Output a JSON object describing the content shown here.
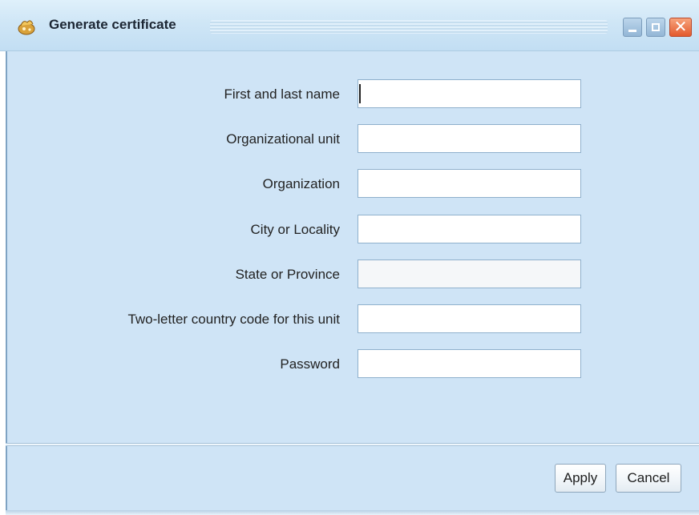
{
  "window": {
    "title": "Generate certificate",
    "icon": "certificate-app-icon",
    "controls": {
      "minimize": "minimize-icon",
      "maximize": "maximize-icon",
      "close": "close-icon",
      "close_glyph": "✕"
    }
  },
  "form": {
    "fields": [
      {
        "label": "First and last name",
        "value": "",
        "focused": true
      },
      {
        "label": "Organizational unit",
        "value": ""
      },
      {
        "label": "Organization",
        "value": ""
      },
      {
        "label": "City or Locality",
        "value": ""
      },
      {
        "label": "State or Province",
        "value": ""
      },
      {
        "label": "Two-letter country code for this unit",
        "value": ""
      },
      {
        "label": "Password",
        "value": ""
      }
    ]
  },
  "buttons": {
    "apply": "Apply",
    "cancel": "Cancel"
  },
  "colors": {
    "panel": "#cfe4f6",
    "titlebar": "#cfe6f6",
    "close": "#e35a2d"
  }
}
